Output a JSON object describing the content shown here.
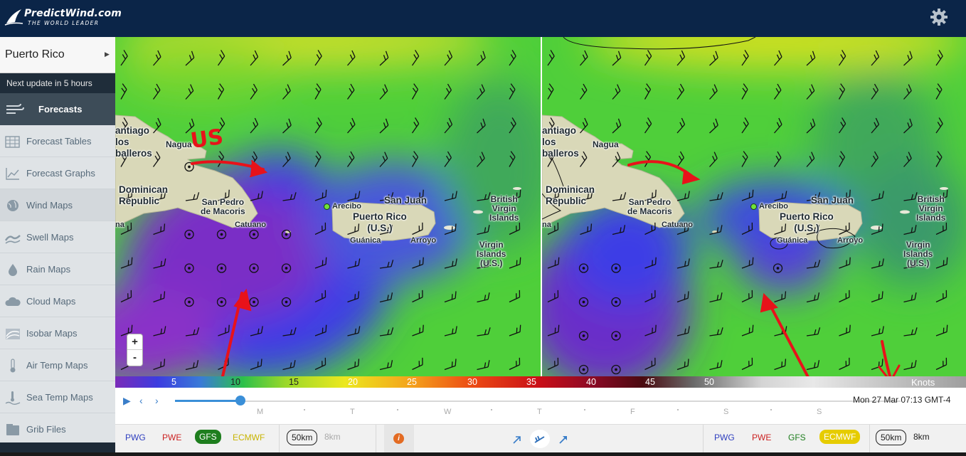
{
  "header": {
    "brand": "PredictWind.com",
    "tagline": "THE WORLD LEADER",
    "settings_icon": "gear-icon"
  },
  "sidebar": {
    "location": "Puerto Rico",
    "next_update": "Next update in 5 hours",
    "section": "Forecasts",
    "items": [
      {
        "label": "Forecast Tables",
        "icon": "table-icon"
      },
      {
        "label": "Forecast Graphs",
        "icon": "graph-icon"
      },
      {
        "label": "Wind Maps",
        "icon": "globe-icon"
      },
      {
        "label": "Swell Maps",
        "icon": "wave-icon"
      },
      {
        "label": "Rain Maps",
        "icon": "drop-icon"
      },
      {
        "label": "Cloud Maps",
        "icon": "cloud-icon"
      },
      {
        "label": "Isobar Maps",
        "icon": "isobar-icon"
      },
      {
        "label": "Air Temp Maps",
        "icon": "thermometer-icon"
      },
      {
        "label": "Sea Temp Maps",
        "icon": "sea-temp-icon"
      },
      {
        "label": "Grib Files",
        "icon": "grib-icon"
      }
    ],
    "active_index": 2
  },
  "map": {
    "places": {
      "santiago": "antiago\nlos\nballeros",
      "santiago_de": "de",
      "nagua": "Nagua",
      "dominican": "Dominican\nRepublic",
      "san_pedro": "San Pedro\nde Macoris",
      "catuano": "Catuano",
      "arecibo": "Arecibo",
      "san_juan": "San Juan",
      "puerto_rico": "Puerto Rico\n(U.S.)",
      "guanica": "Guánica",
      "arroyo": "Arroyo",
      "bvi": "British\nVirgin\nIslands",
      "usvi": "Virgin\nIslands\n(U.S.)",
      "na": "na"
    },
    "annotation": "US",
    "zoom_in": "+",
    "zoom_out": "-"
  },
  "scale": {
    "labels": [
      "5",
      "10",
      "15",
      "20",
      "25",
      "30",
      "35",
      "40",
      "45",
      "50"
    ],
    "unit": "Knots"
  },
  "timeline": {
    "days": [
      "M",
      "T",
      "W",
      "T",
      "F",
      "S",
      "S"
    ],
    "progress_fraction": 0.09,
    "time": "Mon 27 Mar 07:13 GMT-4",
    "play_icon": "play-icon",
    "prev_icon": "chevron-left-icon",
    "next_icon": "chevron-right-icon"
  },
  "bottom": {
    "left_models": [
      "PWG",
      "PWE",
      "GFS",
      "ECMWF"
    ],
    "left_selected": "GFS",
    "right_models": [
      "PWG",
      "PWE",
      "GFS",
      "ECMWF"
    ],
    "right_selected": "ECMWF",
    "res_left": [
      "50km",
      "8km"
    ],
    "res_right": [
      "50km",
      "8km"
    ],
    "info": "i",
    "colors": {
      "PWG": "#2f3fbf",
      "PWE": "#cc2222",
      "GFS": "#1e7e1e",
      "ECMWF": "#c8b400",
      "GFS_sel_bg": "#1e7e1e",
      "ECMWF_sel_bg": "#e6cc00"
    }
  }
}
